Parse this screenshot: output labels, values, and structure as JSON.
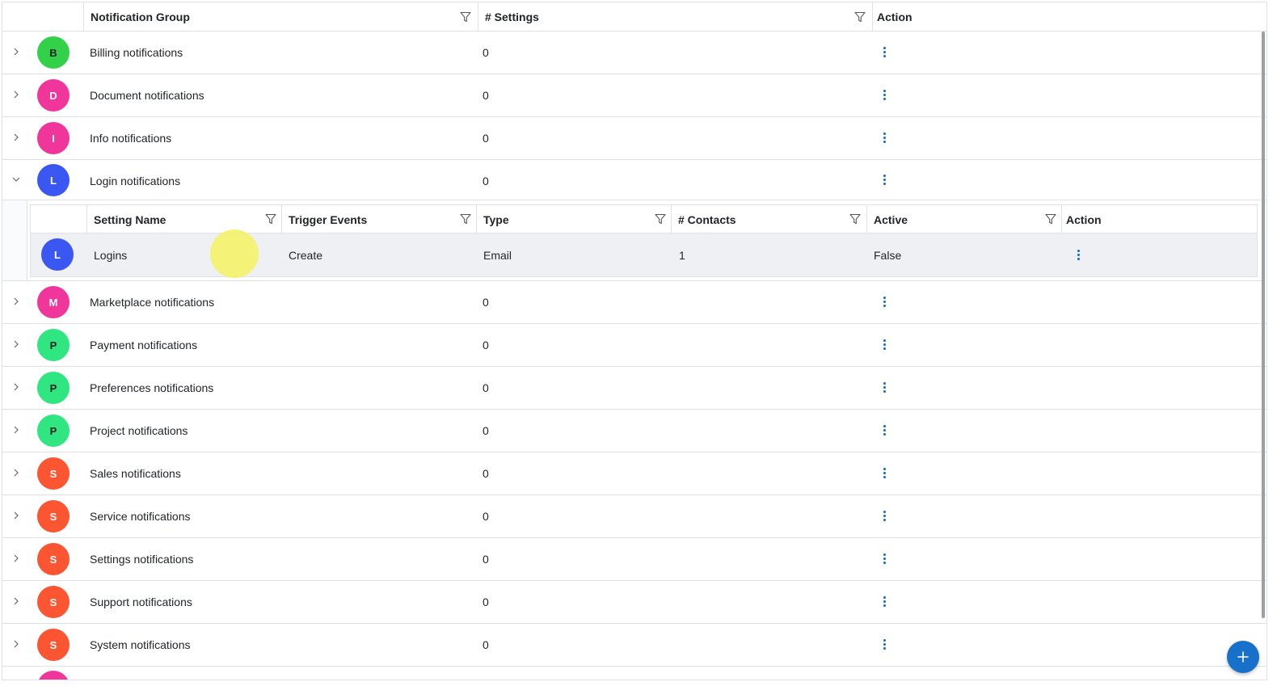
{
  "header": {
    "col_group": "Notification Group",
    "col_settings": "# Settings",
    "col_action": "Action"
  },
  "rows": [
    {
      "initial": "B",
      "name": "Billing notifications",
      "count": "0",
      "color": "#33d14a",
      "expanded": false
    },
    {
      "initial": "D",
      "name": "Document notifications",
      "count": "0",
      "color": "#f0369a",
      "expanded": false
    },
    {
      "initial": "I",
      "name": "Info notifications",
      "count": "0",
      "color": "#f0369a",
      "expanded": false
    },
    {
      "initial": "L",
      "name": "Login notifications",
      "count": "0",
      "color": "#3b57f2",
      "expanded": true
    },
    {
      "initial": "M",
      "name": "Marketplace notifications",
      "count": "0",
      "color": "#f0369a",
      "expanded": false
    },
    {
      "initial": "P",
      "name": "Payment notifications",
      "count": "0",
      "color": "#2fe681",
      "expanded": false
    },
    {
      "initial": "P",
      "name": "Preferences notifications",
      "count": "0",
      "color": "#2fe681",
      "expanded": false
    },
    {
      "initial": "P",
      "name": "Project notifications",
      "count": "0",
      "color": "#2fe681",
      "expanded": false
    },
    {
      "initial": "S",
      "name": "Sales notifications",
      "count": "0",
      "color": "#fb5531",
      "expanded": false
    },
    {
      "initial": "S",
      "name": "Service notifications",
      "count": "0",
      "color": "#fb5531",
      "expanded": false
    },
    {
      "initial": "S",
      "name": "Settings notifications",
      "count": "0",
      "color": "#fb5531",
      "expanded": false
    },
    {
      "initial": "S",
      "name": "Support notifications",
      "count": "0",
      "color": "#fb5531",
      "expanded": false
    },
    {
      "initial": "S",
      "name": "System notifications",
      "count": "0",
      "color": "#fb5531",
      "expanded": false
    }
  ],
  "partial_row": {
    "color": "#f0369a"
  },
  "subgrid": {
    "col_setting_name": "Setting Name",
    "col_trigger": "Trigger Events",
    "col_type": "Type",
    "col_contacts": "# Contacts",
    "col_active": "Active",
    "col_action": "Action",
    "row": {
      "initial": "L",
      "color": "#3b57f2",
      "setting_name": "Logins",
      "trigger": "Create",
      "type": "Email",
      "contacts": "1",
      "active": "False"
    }
  },
  "fab": {
    "icon": "plus-icon"
  }
}
